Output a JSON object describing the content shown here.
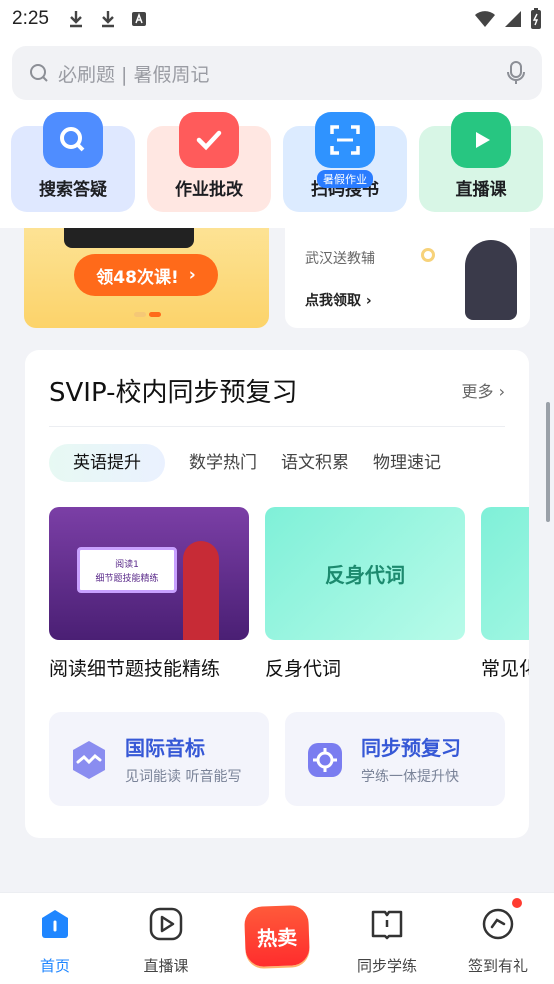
{
  "status_bar": {
    "time": "2:25"
  },
  "search": {
    "placeholder": "必刷题 | 暑假周记"
  },
  "quick_actions": [
    {
      "label": "搜索答疑",
      "icon": "search-icon",
      "color": "#dbe6ff",
      "icon_color": "#3b7dff"
    },
    {
      "label": "作业批改",
      "icon": "check-icon",
      "color": "#ffe6e1",
      "icon_color": "#ff4d4d"
    },
    {
      "label": "扫码搜书",
      "icon": "scan-icon",
      "color": "#dceafe",
      "icon_color": "#2a8cff",
      "badge": "暑假作业"
    },
    {
      "label": "直播课",
      "icon": "play-icon",
      "color": "#d9f6e8",
      "icon_color": "#20c07a"
    }
  ],
  "banners": {
    "left_button": "领48次课!",
    "right_sub": "武汉送教辅",
    "right_link": "点我领取"
  },
  "section": {
    "title": "SVIP-校内同步预复习",
    "more": "更多",
    "tabs": [
      "英语提升",
      "数学热门",
      "语文积累",
      "物理速记"
    ],
    "active_tab": 0,
    "courses": [
      {
        "title": "阅读细节题技能精练",
        "thumb_line1": "阅读1",
        "thumb_line2": "细节题技能精练"
      },
      {
        "title": "反身代词",
        "thumb_text": "反身代词"
      },
      {
        "title": "常见化"
      }
    ],
    "features": [
      {
        "title": "国际音标",
        "sub": "见词能读 听音能写",
        "icon": "wave-icon"
      },
      {
        "title": "同步预复习",
        "sub": "学练一体提升快",
        "icon": "target-icon"
      }
    ]
  },
  "bottom_nav": [
    {
      "label": "首页",
      "icon": "home-icon",
      "active": true
    },
    {
      "label": "直播课",
      "icon": "play-icon"
    },
    {
      "label": "热卖",
      "icon": "hot-icon"
    },
    {
      "label": "同步学练",
      "icon": "book-icon"
    },
    {
      "label": "签到有礼",
      "icon": "checkin-icon"
    }
  ]
}
